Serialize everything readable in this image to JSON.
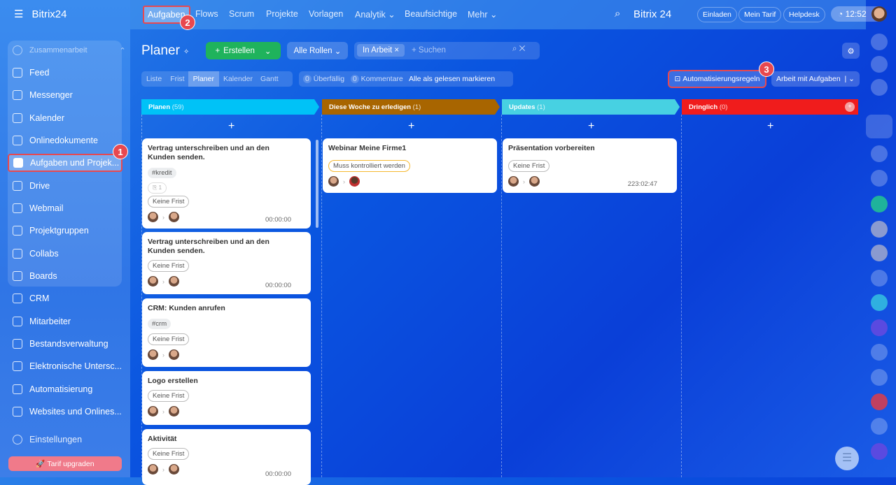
{
  "sidebar": {
    "brand": "Bitrix24",
    "group_label": "Zusammenarbeit",
    "items": [
      "Feed",
      "Messenger",
      "Kalender",
      "Onlinedokumente",
      "Aufgaben und Projek...",
      "Drive",
      "Webmail",
      "Projektgruppen",
      "Collabs",
      "Boards"
    ],
    "items2": [
      "CRM",
      "Mitarbeiter",
      "Bestandsverwaltung",
      "Elektronische Untersc...",
      "Automatisierung",
      "Websites und Onlines..."
    ],
    "settings": "Einstellungen",
    "upgrade": "Tarif upgraden"
  },
  "topnav": {
    "items": [
      "Aufgaben",
      "Flows",
      "Scrum",
      "Projekte",
      "Vorlagen",
      "Analytik ⌄",
      "Beaufsichtige",
      "Mehr ⌄"
    ],
    "brand": "Bitrix 24",
    "invite": "Einladen",
    "tariff": "Mein Tarif",
    "helpdesk": "Helpdesk",
    "clock": "12:52"
  },
  "toolbar": {
    "title": "Planer",
    "create": "Erstellen",
    "roles": "Alle Rollen",
    "filter_chip": "In Arbeit",
    "search_placeholder": "+ Suchen",
    "views": [
      "Liste",
      "Frist",
      "Planer",
      "Kalender",
      "Gantt"
    ],
    "overdue_count": "0",
    "overdue": "Überfällig",
    "comments_count": "0",
    "comments": "Kommentare",
    "mark_read": "Alle als gelesen markieren",
    "automation": "Automatisierungsregeln",
    "work": "Arbeit mit Aufgaben"
  },
  "badges": [
    "1",
    "2",
    "3"
  ],
  "columns": [
    {
      "name": "Planen",
      "count": "(59)",
      "color": "#00c2f7"
    },
    {
      "name": "Diese Woche zu erledigen",
      "count": "(1)",
      "color": "#a86500"
    },
    {
      "name": "Updates",
      "count": "(1)",
      "color": "#47d1e2"
    },
    {
      "name": "Dringlich",
      "count": "(0)",
      "color": "#f01c1c"
    }
  ],
  "cards": {
    "c1": {
      "title": "Vertrag unterschreiben und an den Kunden senden.",
      "tag": "#kredit",
      "attach": "1",
      "deadline": "Keine Frist",
      "time": "00:00:00"
    },
    "c2": {
      "title": "Vertrag unterschreiben und an den Kunden senden.",
      "deadline": "Keine Frist",
      "time": "00:00:00"
    },
    "c3": {
      "title": "CRM: Kunden anrufen",
      "tag": "#crm",
      "deadline": "Keine Frist"
    },
    "c4": {
      "title": "Logo erstellen",
      "deadline": "Keine Frist"
    },
    "c5": {
      "title": "Aktivität",
      "deadline": "Keine Frist",
      "time": "00:00:00"
    },
    "c6": {
      "title": "Webinar Meine Firme1",
      "status": "Muss kontrolliert werden"
    },
    "c7": {
      "title": "Präsentation vorbereiten",
      "deadline": "Keine Frist",
      "time": "223:02:47"
    }
  }
}
